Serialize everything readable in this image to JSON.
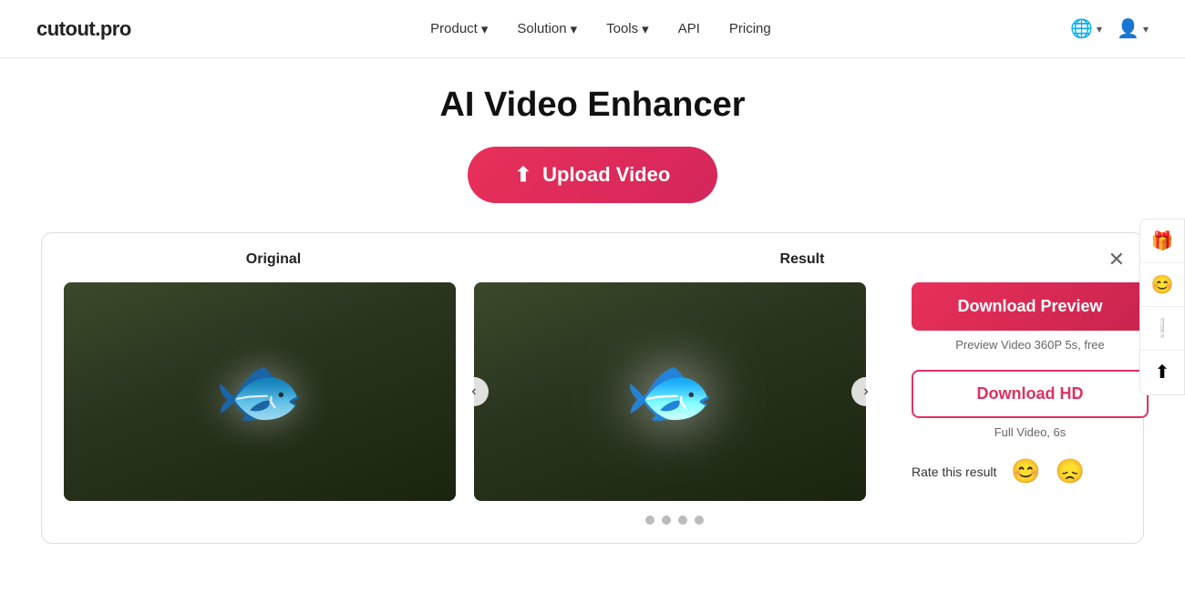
{
  "logo": {
    "text": "cutout.pro"
  },
  "navbar": {
    "links": [
      {
        "label": "Product",
        "hasDropdown": true
      },
      {
        "label": "Solution",
        "hasDropdown": true
      },
      {
        "label": "Tools",
        "hasDropdown": true
      },
      {
        "label": "API",
        "hasDropdown": false
      },
      {
        "label": "Pricing",
        "hasDropdown": false
      }
    ],
    "translate_icon": "🌐",
    "user_icon": "👤"
  },
  "page": {
    "title": "AI Video Enhancer",
    "upload_button": "Upload Video"
  },
  "comparison": {
    "original_label": "Original",
    "result_label": "Result",
    "close_icon": "✕",
    "nav_left": "‹",
    "nav_right": "›",
    "dots": [
      {
        "active": false
      },
      {
        "active": false
      },
      {
        "active": false
      },
      {
        "active": false
      }
    ]
  },
  "actions": {
    "download_preview_label": "Download Preview",
    "preview_note": "Preview Video 360P 5s, free",
    "download_hd_label": "Download HD",
    "full_video_note": "Full Video, 6s",
    "rate_label": "Rate this result",
    "happy_icon": "😊",
    "sad_icon": "😞"
  },
  "sidebar": {
    "gift_icon": "🎁",
    "user_icon": "😊",
    "alert_icon": "❕",
    "upload_icon": "⬆"
  }
}
